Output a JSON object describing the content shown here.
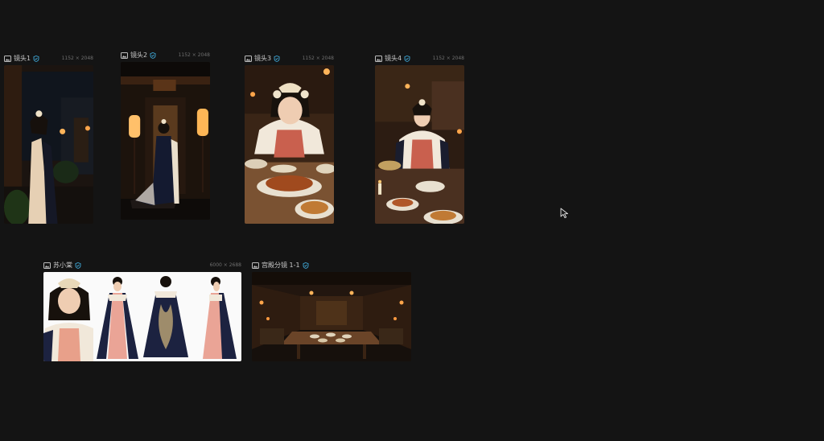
{
  "cards": [
    {
      "title": "镜头1",
      "dimensions": "1152 × 2048"
    },
    {
      "title": "镜头2",
      "dimensions": "1152 × 2048"
    },
    {
      "title": "镜头3",
      "dimensions": "1152 × 2048"
    },
    {
      "title": "镜头4",
      "dimensions": "1152 × 2048"
    },
    {
      "title": "苏小棠",
      "dimensions": "6000 × 2688"
    },
    {
      "title": "宫殿分镜 1-1",
      "dimensions": ""
    }
  ],
  "colors": {
    "canvas_bg": "#141414",
    "verified_badge": "#3fa7d6",
    "title_text": "#c9c9c9",
    "dims_text": "#6f6f6f"
  }
}
